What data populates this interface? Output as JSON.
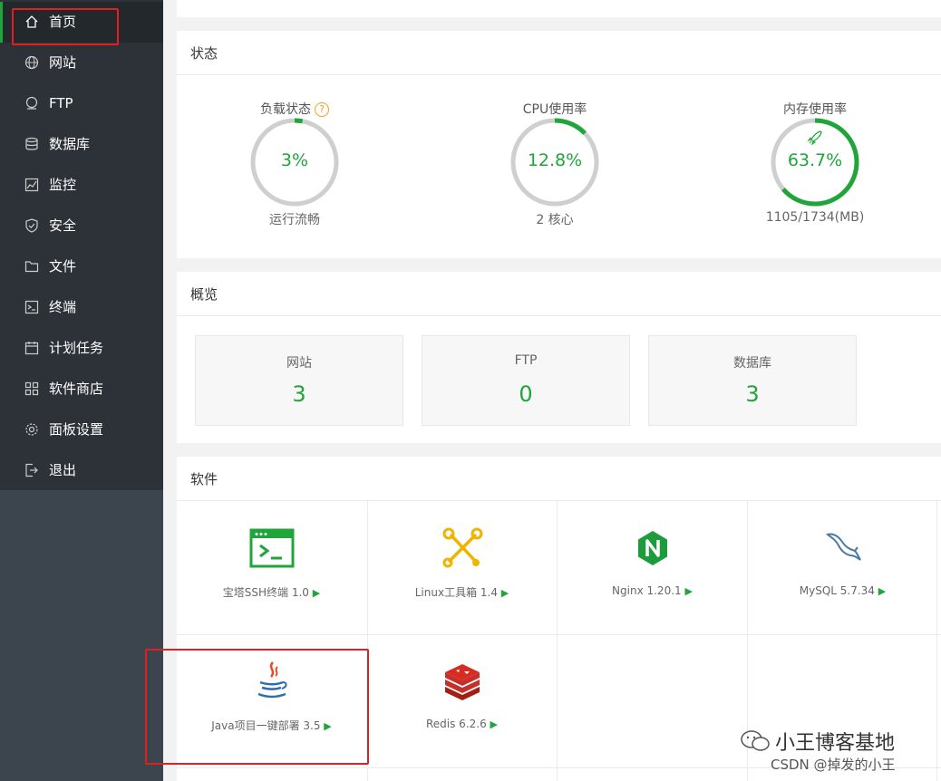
{
  "sidebar": {
    "items": [
      {
        "label": "首页",
        "icon": "home-icon"
      },
      {
        "label": "网站",
        "icon": "globe-icon"
      },
      {
        "label": "FTP",
        "icon": "ftp-icon"
      },
      {
        "label": "数据库",
        "icon": "database-icon"
      },
      {
        "label": "监控",
        "icon": "monitor-icon"
      },
      {
        "label": "安全",
        "icon": "shield-icon"
      },
      {
        "label": "文件",
        "icon": "folder-icon"
      },
      {
        "label": "终端",
        "icon": "terminal-icon"
      },
      {
        "label": "计划任务",
        "icon": "calendar-icon"
      },
      {
        "label": "软件商店",
        "icon": "apps-icon"
      },
      {
        "label": "面板设置",
        "icon": "gear-icon"
      },
      {
        "label": "退出",
        "icon": "logout-icon"
      }
    ],
    "active_index": 0
  },
  "status": {
    "title": "状态",
    "gauges": [
      {
        "label": "负载状态",
        "value": "3%",
        "sub": "运行流畅",
        "percent": 3,
        "help": "?"
      },
      {
        "label": "CPU使用率",
        "value": "12.8%",
        "sub": "2 核心",
        "percent": 12.8
      },
      {
        "label": "内存使用率",
        "value": "63.7%",
        "sub": "1105/1734(MB)",
        "percent": 63.7,
        "icon": "rocket-icon"
      }
    ]
  },
  "overview": {
    "title": "概览",
    "cards": [
      {
        "name": "网站",
        "count": "3"
      },
      {
        "name": "FTP",
        "count": "0"
      },
      {
        "name": "数据库",
        "count": "3"
      }
    ]
  },
  "software": {
    "title": "软件",
    "items": [
      {
        "name": "宝塔SSH终端 1.0",
        "icon": "ssh-terminal-icon"
      },
      {
        "name": "Linux工具箱 1.4",
        "icon": "toolbox-icon"
      },
      {
        "name": "Nginx 1.20.1",
        "icon": "nginx-icon"
      },
      {
        "name": "MySQL 5.7.34",
        "icon": "mysql-dolphin-icon"
      },
      {
        "name": "Java项目一键部署 3.5",
        "icon": "java-icon"
      },
      {
        "name": "Redis 6.2.6",
        "icon": "redis-icon"
      }
    ],
    "play_glyph": "▶"
  },
  "watermark": {
    "line1": "小王博客基地",
    "line2": "CSDN @掉发的小王"
  },
  "colors": {
    "accent": "#20a53a",
    "sidebar": "#2d3238",
    "highlight": "#e02020"
  }
}
